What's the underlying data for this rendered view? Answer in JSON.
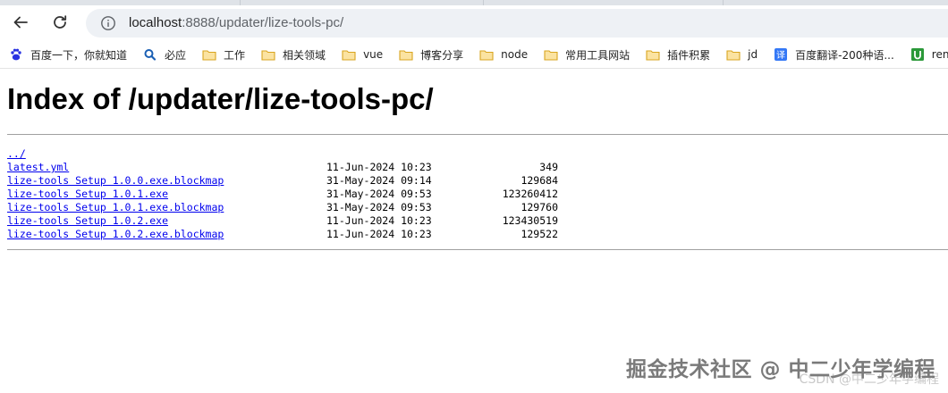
{
  "browser": {
    "url_host": "localhost",
    "url_rest": ":8888/updater/lize-tools-pc/"
  },
  "bookmarks": [
    {
      "label": "百度一下，你就知道",
      "icon": "baidu-paw-icon"
    },
    {
      "label": "必应",
      "icon": "bing-search-icon"
    },
    {
      "label": "工作",
      "icon": "folder-icon"
    },
    {
      "label": "相关领域",
      "icon": "folder-icon"
    },
    {
      "label": "vue",
      "icon": "folder-icon"
    },
    {
      "label": "博客分享",
      "icon": "folder-icon"
    },
    {
      "label": "node",
      "icon": "folder-icon"
    },
    {
      "label": "常用工具网站",
      "icon": "folder-icon"
    },
    {
      "label": "插件积累",
      "icon": "folder-icon"
    },
    {
      "label": "jd",
      "icon": "folder-icon"
    },
    {
      "label": "百度翻译-200种语...",
      "icon": "baidu-translate-icon"
    },
    {
      "label": "renderjs |",
      "icon": "uniapp-icon"
    }
  ],
  "page": {
    "title": "Index of /updater/lize-tools-pc/",
    "parent_link": "../",
    "files": [
      {
        "name": "latest.yml",
        "date": "11-Jun-2024 10:23",
        "size": "349"
      },
      {
        "name": "lize-tools Setup 1.0.0.exe.blockmap",
        "date": "31-May-2024 09:14",
        "size": "129684"
      },
      {
        "name": "lize-tools Setup 1.0.1.exe",
        "date": "31-May-2024 09:53",
        "size": "123260412"
      },
      {
        "name": "lize-tools Setup 1.0.1.exe.blockmap",
        "date": "31-May-2024 09:53",
        "size": "129760"
      },
      {
        "name": "lize-tools Setup 1.0.2.exe",
        "date": "11-Jun-2024 10:23",
        "size": "123430519"
      },
      {
        "name": "lize-tools Setup 1.0.2.exe.blockmap",
        "date": "11-Jun-2024 10:23",
        "size": "129522"
      }
    ]
  },
  "watermark": {
    "text": "掘金技术社区 @ 中二少年学编程",
    "subtext": "CSDN @中二少年学编程"
  },
  "colors": {
    "link": "#0000ee",
    "folder": "#f2c24e",
    "baidu": "#2932e1",
    "translate": "#3478f6",
    "uniapp": "#2b9939"
  }
}
